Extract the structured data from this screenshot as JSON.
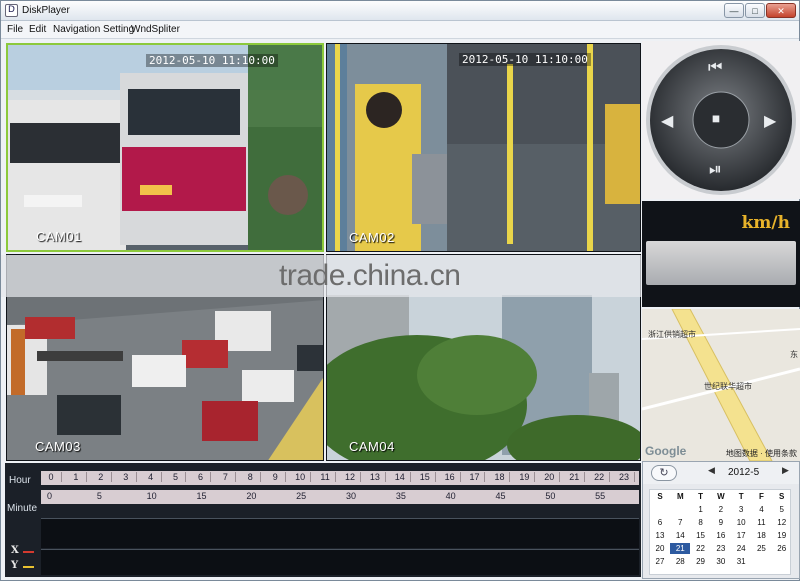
{
  "window": {
    "title": "DiskPlayer",
    "app_icon": "disk-player-icon",
    "min_label": "—",
    "max_label": "□",
    "close_label": "✕"
  },
  "menu": {
    "items": [
      "File",
      "Edit",
      "Navigation Setting",
      "WndSpliter"
    ]
  },
  "cameras": [
    {
      "label": "CAM01",
      "timestamp": "2012-05-10 11:10:00",
      "selected": true
    },
    {
      "label": "CAM02",
      "timestamp": "2012-05-10 11:10:00",
      "selected": false
    },
    {
      "label": "CAM03",
      "timestamp": "",
      "selected": false
    },
    {
      "label": "CAM04",
      "timestamp": "",
      "selected": false
    }
  ],
  "controls": {
    "prev": "◀",
    "next": "▶",
    "first": "⏮",
    "pause": "⏯",
    "stop": "⏹"
  },
  "speed": {
    "unit": "km/h"
  },
  "map": {
    "labels": [
      "浙江供销超市",
      "世纪联华超市",
      "东"
    ],
    "copyright": "地图数据 · 使用条款",
    "logo": "Google"
  },
  "watermark": "trade.china.cn",
  "timeline": {
    "hour_label": "Hour",
    "minute_label": "Minute",
    "hours": [
      "0",
      "1",
      "2",
      "3",
      "4",
      "5",
      "6",
      "7",
      "8",
      "9",
      "10",
      "11",
      "12",
      "13",
      "14",
      "15",
      "16",
      "17",
      "18",
      "19",
      "20",
      "21",
      "22",
      "23"
    ],
    "minutes": [
      "0",
      "5",
      "10",
      "15",
      "20",
      "25",
      "30",
      "35",
      "40",
      "45",
      "50",
      "55"
    ],
    "x_label": "X",
    "y_label": "Y",
    "colors": {
      "x": "#d33a2f",
      "y": "#e8c130"
    }
  },
  "calendar": {
    "refresh_icon": "refresh-icon",
    "prev": "◀",
    "next": "▶",
    "month": "2012-5",
    "weekdays": [
      "S",
      "M",
      "T",
      "W",
      "T",
      "F",
      "S"
    ],
    "weeks": [
      [
        "",
        "",
        "1",
        "2",
        "3",
        "4",
        "5"
      ],
      [
        "6",
        "7",
        "8",
        "9",
        "10",
        "11",
        "12"
      ],
      [
        "13",
        "14",
        "15",
        "16",
        "17",
        "18",
        "19"
      ],
      [
        "20",
        "21",
        "22",
        "23",
        "24",
        "25",
        "26"
      ],
      [
        "27",
        "28",
        "29",
        "30",
        "31",
        "",
        ""
      ]
    ],
    "selected": "21"
  }
}
